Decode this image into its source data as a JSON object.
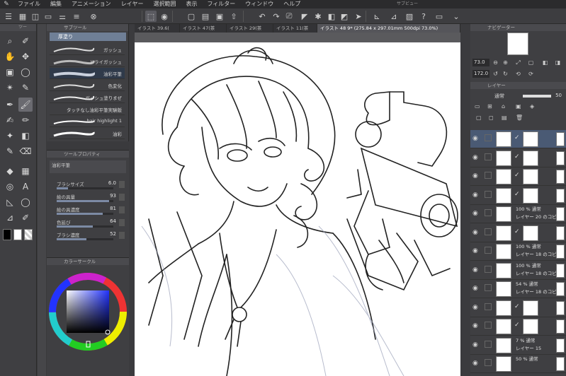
{
  "menu": {
    "items": [
      "ファイル",
      "編集",
      "アニメーション",
      "レイヤー",
      "選択範囲",
      "表示",
      "フィルター",
      "ウィンドウ",
      "ヘルプ"
    ],
    "subview_title": "サブビュー"
  },
  "palette_headers": {
    "tool": "ツー",
    "subtool": "サブツール",
    "toolprop": "ツールプロパティ",
    "color": "カラーサークル",
    "navigator": "ナビゲーター",
    "layer": "レイヤー"
  },
  "subtool": {
    "active_tab": "厚塗り",
    "brushes": [
      "ガッシュ",
      "ドライガッシュ",
      "油彩平筆",
      "色変化",
      "ガッシュ塗りまぜ",
      "タッチなし油彩平筆実験版",
      "hair highlight 1",
      "油彩"
    ]
  },
  "toolprop": {
    "name": "油彩平筆",
    "rows": [
      {
        "label": "ブラシサイズ",
        "value": "6.0",
        "fill": 0.2
      },
      {
        "label": "絵の具量",
        "value": "93",
        "fill": 0.93
      },
      {
        "label": "絵の具濃度",
        "value": "81",
        "fill": 0.81
      },
      {
        "label": "色延び",
        "value": "64",
        "fill": 0.64
      },
      {
        "label": "ブラシ濃度",
        "value": "52",
        "fill": 0.52
      }
    ]
  },
  "canvas": {
    "tabs": [
      "イラスト 39.6(",
      "イラスト 47(茶",
      "イラスト 29(茶",
      "イラスト 11(茶",
      "イラスト 48 9* (275.84 x 297.01mm 500dpi 73.0%)"
    ]
  },
  "navigator": {
    "zoom": "73.0",
    "angle": "172.0"
  },
  "layer_panel": {
    "blend_mode": "通常",
    "opacity": "50",
    "layers": [
      {
        "info1": "",
        "info2": ""
      },
      {
        "info1": "",
        "info2": ""
      },
      {
        "info1": "",
        "info2": ""
      },
      {
        "info1": "",
        "info2": ""
      },
      {
        "info1": "100 % 通常",
        "info2": "レイヤー 20 のコピ"
      },
      {
        "info1": "",
        "info2": ""
      },
      {
        "info1": "100 % 通常",
        "info2": "レイヤー 18 のコピ"
      },
      {
        "info1": "100 % 通常",
        "info2": "レイヤー 18 のコピ"
      },
      {
        "info1": "54 % 通常",
        "info2": "レイヤー 18 のコピ"
      },
      {
        "info1": "",
        "info2": ""
      },
      {
        "info1": "",
        "info2": ""
      },
      {
        "info1": "7 % 通常",
        "info2": "レイヤー 15"
      },
      {
        "info1": "50 % 通常",
        "info2": ""
      }
    ]
  },
  "colors": {
    "main": "#000000",
    "sub": "#ffffff",
    "panel": "#3f3f42",
    "selection": "#6f7f96"
  }
}
